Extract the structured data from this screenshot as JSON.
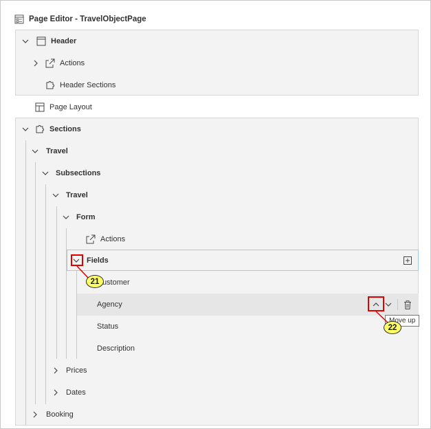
{
  "title": "Page Editor - TravelObjectPage",
  "tree": {
    "header": {
      "label": "Header"
    },
    "header_actions": {
      "label": "Actions"
    },
    "header_sections": {
      "label": "Header Sections"
    },
    "page_layout": {
      "label": "Page Layout"
    },
    "sections": {
      "label": "Sections"
    },
    "travel_section": {
      "label": "Travel"
    },
    "subsections": {
      "label": "Subsections"
    },
    "travel_subsection": {
      "label": "Travel"
    },
    "form": {
      "label": "Form"
    },
    "form_actions": {
      "label": "Actions"
    },
    "fields": {
      "label": "Fields"
    },
    "field_items": [
      {
        "label": "Customer"
      },
      {
        "label": "Agency"
      },
      {
        "label": "Status"
      },
      {
        "label": "Description"
      }
    ],
    "prices": {
      "label": "Prices"
    },
    "dates": {
      "label": "Dates"
    },
    "booking": {
      "label": "Booking"
    }
  },
  "tooltip": "Move up",
  "callouts": {
    "first": "21",
    "second": "22"
  },
  "colors": {
    "annotation_red": "#e00000",
    "callout_fill": "#ffff66",
    "selection_border": "#9ccbea"
  }
}
